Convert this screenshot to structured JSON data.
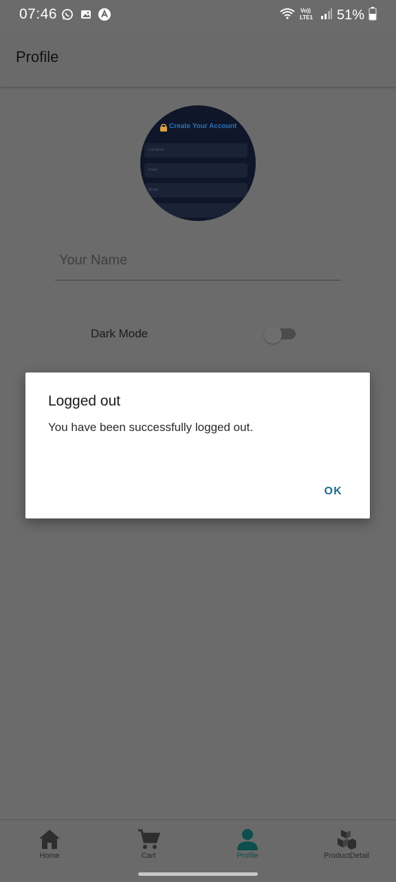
{
  "status_bar": {
    "time": "07:46",
    "battery_percent": "51%",
    "network_label": "VoLTE1",
    "icons": [
      "whatsapp-icon",
      "gallery-icon",
      "app-icon",
      "wifi-icon",
      "volte-icon",
      "signal-icon",
      "battery-icon"
    ]
  },
  "app_bar": {
    "title": "Profile"
  },
  "avatar": {
    "preview_title": "Create Your Account",
    "preview_fields": [
      "Full Name",
      "Email",
      "Mobile"
    ]
  },
  "name_field": {
    "placeholder": "Your Name",
    "value": ""
  },
  "dark_mode": {
    "label": "Dark Mode",
    "enabled": false
  },
  "dialog": {
    "title": "Logged out",
    "message": "You have been successfully logged out.",
    "ok_label": "OK",
    "accent_color": "#1e6b8f"
  },
  "bottom_nav": {
    "items": [
      {
        "label": "Home",
        "icon": "home-icon",
        "active": false
      },
      {
        "label": "Cart",
        "icon": "cart-icon",
        "active": false
      },
      {
        "label": "Profile",
        "icon": "person-icon",
        "active": true
      },
      {
        "label": "ProductDetail",
        "icon": "boxes-icon",
        "active": false
      }
    ],
    "active_color": "#0d4f4f"
  },
  "colors": {
    "overlay": "#6b6b6b",
    "avatar_bg": "#0f1629"
  }
}
